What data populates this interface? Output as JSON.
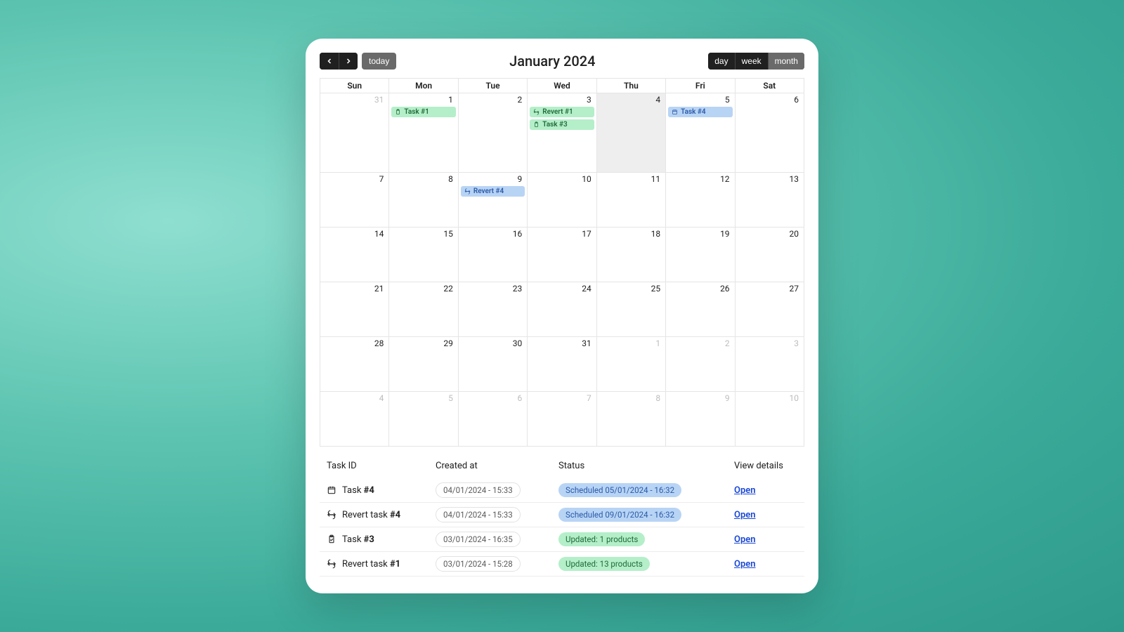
{
  "toolbar": {
    "today_label": "today",
    "title": "January 2024",
    "views": {
      "day": "day",
      "week": "week",
      "month": "month",
      "active": "month"
    }
  },
  "dow": [
    "Sun",
    "Mon",
    "Tue",
    "Wed",
    "Thu",
    "Fri",
    "Sat"
  ],
  "weeks": [
    [
      {
        "n": "31",
        "other": true
      },
      {
        "n": "1",
        "events": [
          {
            "label": "Task #1",
            "color": "green",
            "icon": "clipboard"
          }
        ]
      },
      {
        "n": "2"
      },
      {
        "n": "3",
        "events": [
          {
            "label": "Revert #1",
            "color": "green",
            "icon": "revert"
          },
          {
            "label": "Task #3",
            "color": "green",
            "icon": "clipboard"
          }
        ]
      },
      {
        "n": "4",
        "today": true
      },
      {
        "n": "5",
        "events": [
          {
            "label": "Task #4",
            "color": "blue",
            "icon": "calendar"
          }
        ]
      },
      {
        "n": "6"
      }
    ],
    [
      {
        "n": "7"
      },
      {
        "n": "8"
      },
      {
        "n": "9",
        "events": [
          {
            "label": "Revert #4",
            "color": "blue",
            "icon": "revert"
          }
        ]
      },
      {
        "n": "10"
      },
      {
        "n": "11"
      },
      {
        "n": "12"
      },
      {
        "n": "13"
      }
    ],
    [
      {
        "n": "14"
      },
      {
        "n": "15"
      },
      {
        "n": "16"
      },
      {
        "n": "17"
      },
      {
        "n": "18"
      },
      {
        "n": "19"
      },
      {
        "n": "20"
      }
    ],
    [
      {
        "n": "21"
      },
      {
        "n": "22"
      },
      {
        "n": "23"
      },
      {
        "n": "24"
      },
      {
        "n": "25"
      },
      {
        "n": "26"
      },
      {
        "n": "27"
      }
    ],
    [
      {
        "n": "28"
      },
      {
        "n": "29"
      },
      {
        "n": "30"
      },
      {
        "n": "31"
      },
      {
        "n": "1",
        "other": true
      },
      {
        "n": "2",
        "other": true
      },
      {
        "n": "3",
        "other": true
      }
    ],
    [
      {
        "n": "4",
        "other": true
      },
      {
        "n": "5",
        "other": true
      },
      {
        "n": "6",
        "other": true
      },
      {
        "n": "7",
        "other": true
      },
      {
        "n": "8",
        "other": true
      },
      {
        "n": "9",
        "other": true
      },
      {
        "n": "10",
        "other": true
      }
    ]
  ],
  "table": {
    "headers": {
      "id": "Task ID",
      "created": "Created at",
      "status": "Status",
      "view": "View details"
    },
    "open_label": "Open",
    "rows": [
      {
        "icon": "calendar",
        "id_prefix": "Task ",
        "id_bold": "#4",
        "created": "04/01/2024 - 15:33",
        "status": "Scheduled 05/01/2024 - 16:32",
        "status_color": "blue"
      },
      {
        "icon": "revert",
        "id_prefix": "Revert task ",
        "id_bold": "#4",
        "created": "04/01/2024 - 15:33",
        "status": "Scheduled 09/01/2024 - 16:32",
        "status_color": "blue"
      },
      {
        "icon": "clipboard-check",
        "id_prefix": "Task ",
        "id_bold": "#3",
        "created": "03/01/2024 - 16:35",
        "status": "Updated: 1 products",
        "status_color": "green"
      },
      {
        "icon": "revert",
        "id_prefix": "Revert task ",
        "id_bold": "#1",
        "created": "03/01/2024 - 15:28",
        "status": "Updated: 13 products",
        "status_color": "green"
      }
    ]
  }
}
